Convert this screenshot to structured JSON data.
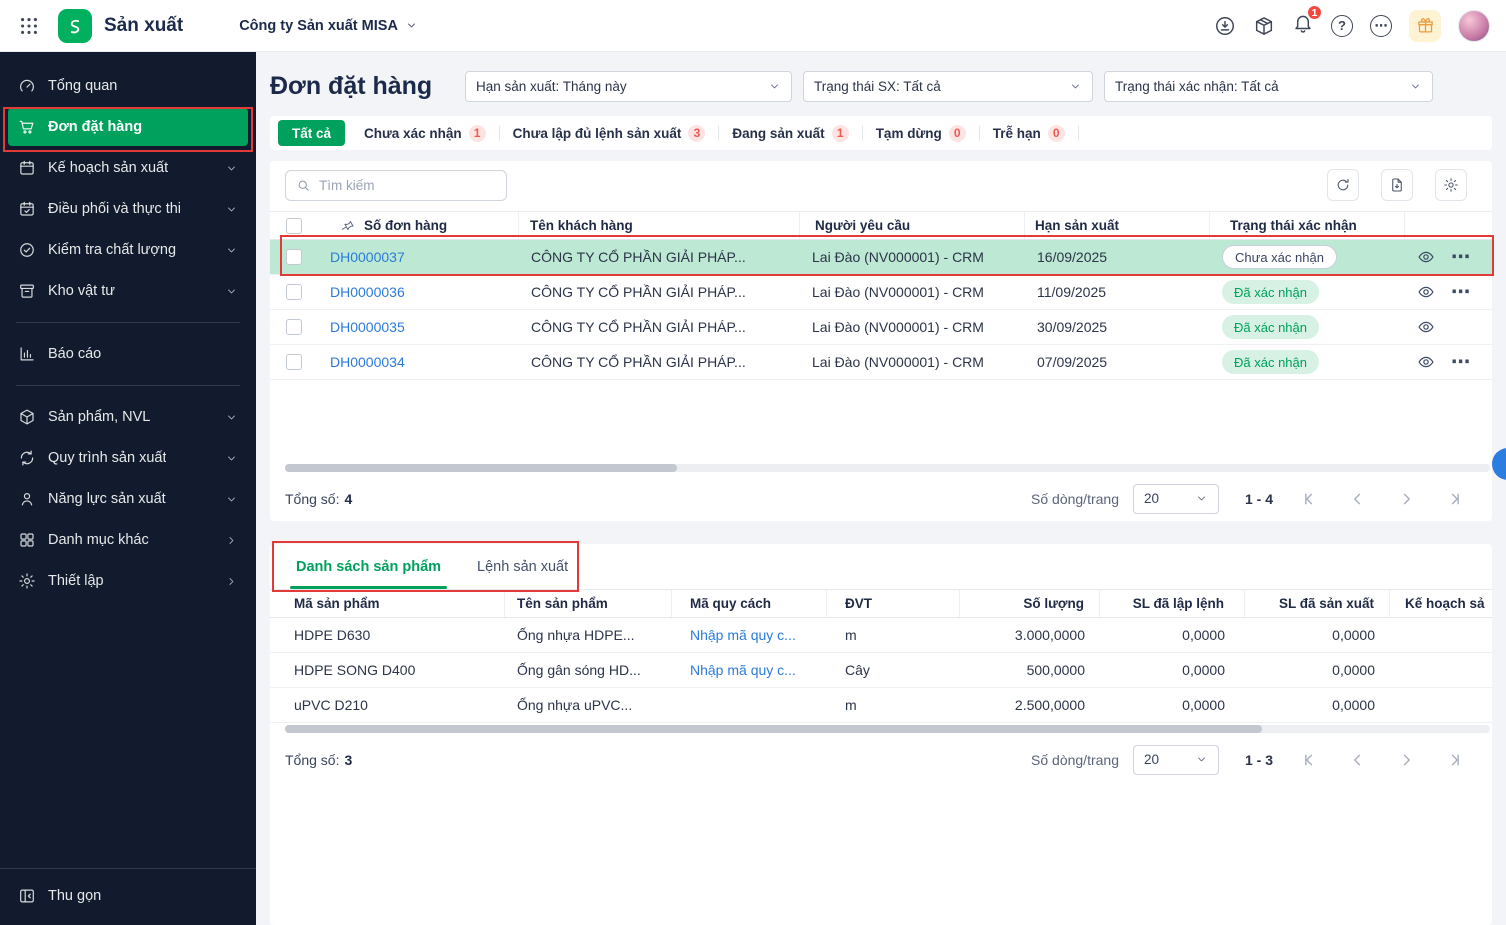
{
  "topbar": {
    "app_title": "Sản xuất",
    "company_name": "Công ty Sản xuất MISA",
    "notification_badge": "1",
    "help_glyph": "?",
    "more_glyph": "⋯"
  },
  "sidebar": {
    "items": [
      {
        "label": "Tổng quan",
        "icon": "gauge"
      },
      {
        "label": "Đơn đặt hàng",
        "icon": "cart",
        "active": true
      },
      {
        "label": "Kế hoạch sản xuất",
        "icon": "calendar",
        "chevron": "down"
      },
      {
        "label": "Điều phối và thực thi",
        "icon": "calendar-check",
        "chevron": "down"
      },
      {
        "label": "Kiểm tra chất lượng",
        "icon": "quality",
        "chevron": "down"
      },
      {
        "label": "Kho vật tư",
        "icon": "warehouse",
        "chevron": "down",
        "divider_after": true
      },
      {
        "label": "Báo cáo",
        "icon": "report",
        "divider_after": true
      },
      {
        "label": "Sản phẩm, NVL",
        "icon": "cube",
        "chevron": "down"
      },
      {
        "label": "Quy trình sản xuất",
        "icon": "process",
        "chevron": "down"
      },
      {
        "label": "Năng lực sản xuất",
        "icon": "person",
        "chevron": "down"
      },
      {
        "label": "Danh mục khác",
        "icon": "grid4",
        "chevron": "right"
      },
      {
        "label": "Thiết lập",
        "icon": "gear",
        "chevron": "right"
      }
    ],
    "collapse_label": "Thu gọn"
  },
  "page": {
    "title": "Đơn đặt hàng",
    "filters": [
      "Hạn sản xuất: Tháng này",
      "Trạng thái SX: Tất cả",
      "Trạng thái xác nhận: Tất cả"
    ],
    "status_tabs": [
      {
        "label": "Tất cả",
        "active": true
      },
      {
        "label": "Chưa xác nhận",
        "count": "1"
      },
      {
        "label": "Chưa lập đủ lệnh sản xuất",
        "count": "3"
      },
      {
        "label": "Đang sản xuất",
        "count": "1"
      },
      {
        "label": "Tạm dừng",
        "count": "0"
      },
      {
        "label": "Trễ hạn",
        "count": "0"
      }
    ]
  },
  "orders": {
    "search_placeholder": "Tìm kiếm",
    "columns": {
      "code": "Số đơn hàng",
      "customer": "Tên khách hàng",
      "requester": "Người yêu cầu",
      "deadline": "Hạn sản xuất",
      "status": "Trạng thái xác nhận"
    },
    "rows": [
      {
        "code": "DH0000037",
        "customer": "CÔNG TY CỔ PHẦN GIẢI PHÁP...",
        "requester": "Lai Đào (NV000001) - CRM",
        "deadline": "16/09/2025",
        "status": "Chưa xác nhận",
        "status_type": "pending",
        "selected": true,
        "has_more": true
      },
      {
        "code": "DH0000036",
        "customer": "CÔNG TY CỔ PHẦN GIẢI PHÁP...",
        "requester": "Lai Đào (NV000001) - CRM",
        "deadline": "11/09/2025",
        "status": "Đã xác nhận",
        "status_type": "confirmed",
        "selected": false,
        "has_more": true
      },
      {
        "code": "DH0000035",
        "customer": "CÔNG TY CỔ PHẦN GIẢI PHÁP...",
        "requester": "Lai Đào (NV000001) - CRM",
        "deadline": "30/09/2025",
        "status": "Đã xác nhận",
        "status_type": "confirmed",
        "selected": false,
        "has_more": false
      },
      {
        "code": "DH0000034",
        "customer": "CÔNG TY CỔ PHẦN GIẢI PHÁP...",
        "requester": "Lai Đào (NV000001) - CRM",
        "deadline": "07/09/2025",
        "status": "Đã xác nhận",
        "status_type": "confirmed",
        "selected": false,
        "has_more": true
      }
    ],
    "footer": {
      "total_label": "Tổng số:",
      "total_value": "4",
      "per_page_label": "Số dòng/trang",
      "per_page_value": "20",
      "range": "1 - 4"
    }
  },
  "products_panel": {
    "tabs": [
      {
        "label": "Danh sách sản phẩm",
        "active": true
      },
      {
        "label": "Lệnh sản xuất",
        "active": false
      }
    ],
    "columns": {
      "code": "Mã sản phẩm",
      "name": "Tên sản phẩm",
      "spec": "Mã quy cách",
      "unit": "ĐVT",
      "qty": "Số lượng",
      "qty_ordered": "SL đã lập lệnh",
      "qty_produced": "SL đã sản xuất",
      "plan": "Kế hoạch sả"
    },
    "rows": [
      {
        "code": "HDPE D630",
        "name": "Ống nhựa HDPE...",
        "spec": "Nhập mã quy c...",
        "unit": "m",
        "qty": "3.000,0000",
        "qty_ordered": "0,0000",
        "qty_produced": "0,0000"
      },
      {
        "code": "HDPE SONG D400",
        "name": "Ống gân sóng HD...",
        "spec": "Nhập mã quy c...",
        "unit": "Cây",
        "qty": "500,0000",
        "qty_ordered": "0,0000",
        "qty_produced": "0,0000"
      },
      {
        "code": "uPVC D210",
        "name": "Ống nhựa uPVC...",
        "spec": "",
        "unit": "m",
        "qty": "2.500,0000",
        "qty_ordered": "0,0000",
        "qty_produced": "0,0000"
      }
    ],
    "footer": {
      "total_label": "Tổng số:",
      "total_value": "3",
      "per_page_label": "Số dòng/trang",
      "per_page_value": "20",
      "range": "1 - 3"
    }
  },
  "colors": {
    "brand_green": "#00a15c",
    "sidebar_bg": "#111b2d",
    "selected_row_bg": "#bde8d3",
    "confirmed_badge_bg": "#d7f2e4",
    "confirmed_badge_text": "#00a05b",
    "count_badge_bg": "#fde3e2",
    "count_badge_text": "#ee5a52",
    "link_blue": "#2c7bdb",
    "annotation_red": "#e23a36"
  }
}
